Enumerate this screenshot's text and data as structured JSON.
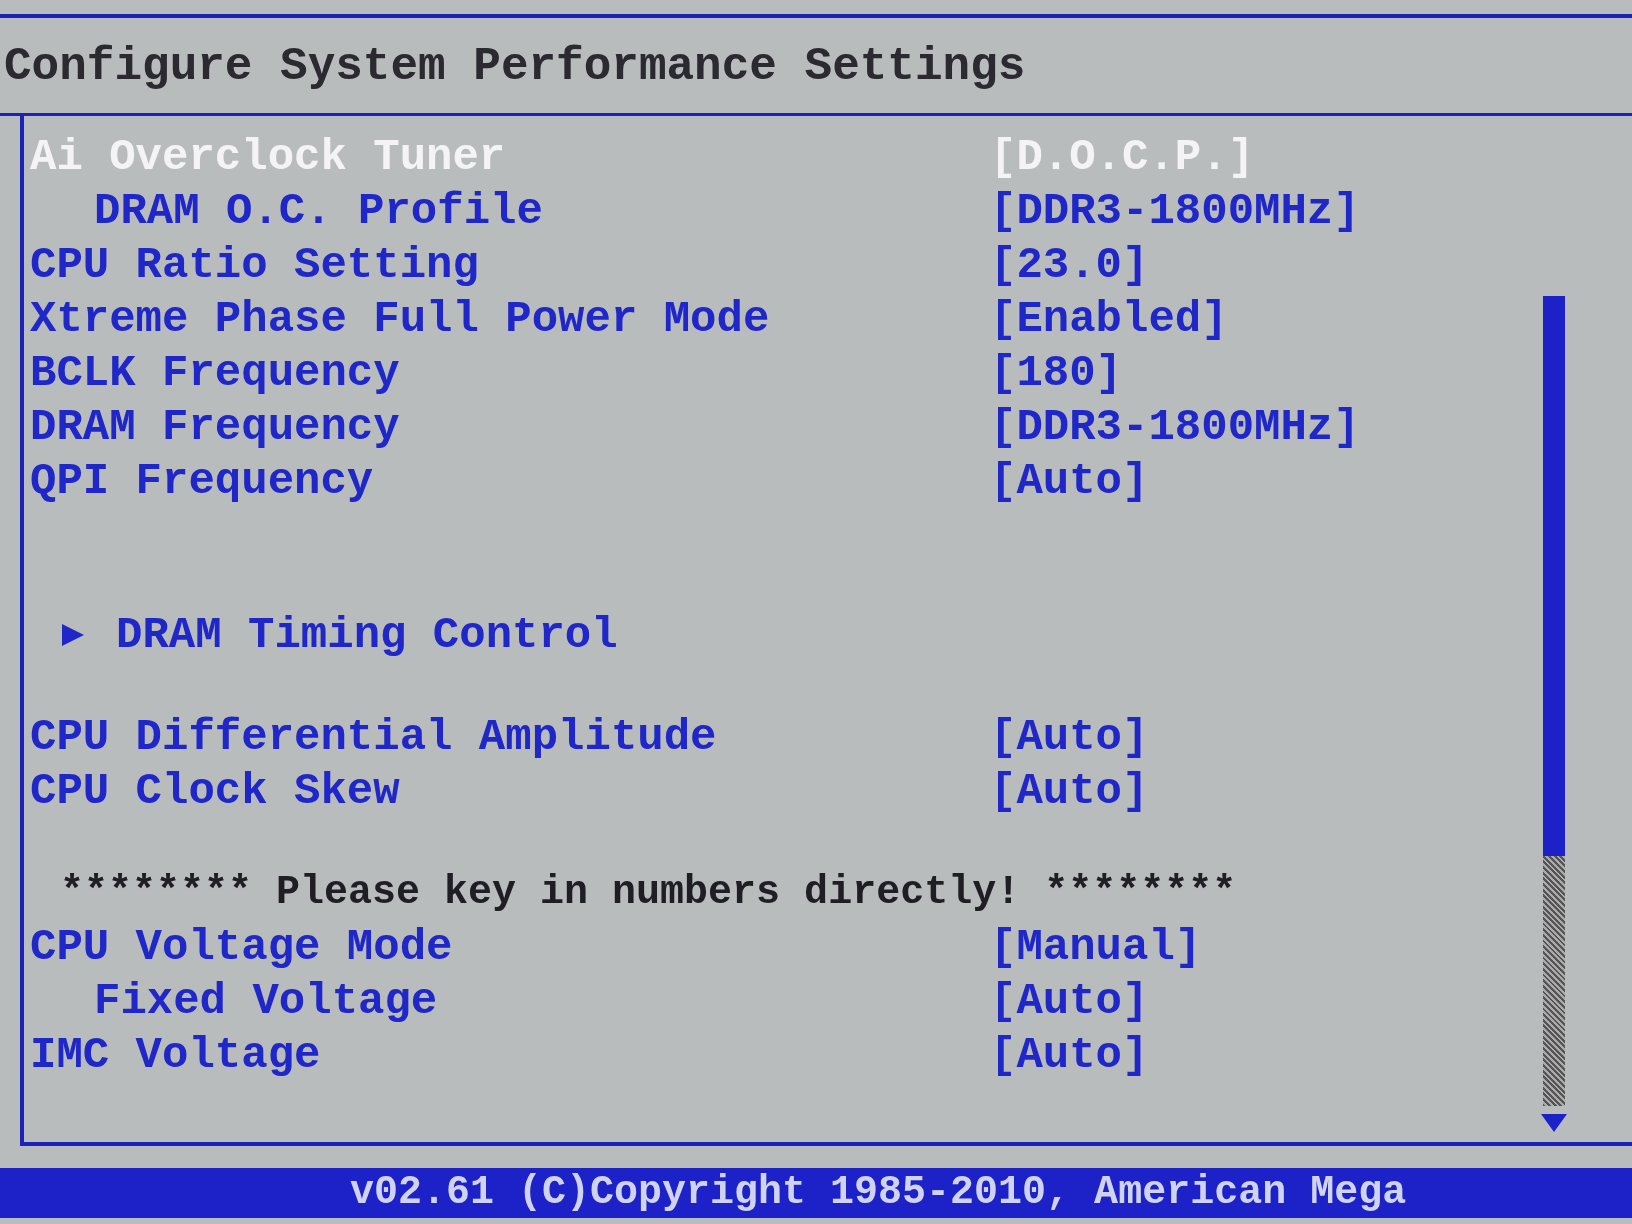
{
  "title": "Configure System Performance Settings",
  "groups": [
    {
      "items": [
        {
          "kind": "setting",
          "label": "Ai Overclock Tuner",
          "value": "[D.O.C.P.]",
          "selected": true,
          "children": [
            {
              "kind": "setting",
              "label": "DRAM O.C. Profile",
              "value": "[DDR3-1800MHz]",
              "selected": false
            }
          ]
        },
        {
          "kind": "setting",
          "label": "CPU Ratio Setting",
          "value": "[23.0]",
          "selected": false
        },
        {
          "kind": "setting",
          "label": "Xtreme Phase Full Power Mode",
          "value": "[Enabled]",
          "selected": false
        },
        {
          "kind": "setting",
          "label": "BCLK Frequency",
          "value": "[180]",
          "selected": false
        },
        {
          "kind": "setting",
          "label": "DRAM Frequency",
          "value": "[DDR3-1800MHz]",
          "selected": false
        },
        {
          "kind": "setting",
          "label": "QPI Frequency",
          "value": "[Auto]",
          "selected": false
        }
      ]
    },
    {
      "items": [
        {
          "kind": "submenu",
          "label": "DRAM Timing Control",
          "selected": false
        }
      ]
    },
    {
      "items": [
        {
          "kind": "setting",
          "label": "CPU Differential Amplitude",
          "value": "[Auto]",
          "selected": false
        },
        {
          "kind": "setting",
          "label": "CPU Clock Skew",
          "value": "[Auto]",
          "selected": false
        }
      ]
    },
    {
      "items": [
        {
          "kind": "note",
          "label": "******** Please key in numbers directly! ********"
        },
        {
          "kind": "setting",
          "label": "CPU Voltage Mode",
          "value": "[Manual]",
          "selected": false,
          "children": [
            {
              "kind": "setting",
              "label": "Fixed Voltage",
              "value": "[Auto]",
              "selected": false
            }
          ]
        },
        {
          "kind": "setting",
          "label": "IMC Voltage",
          "value": "[Auto]",
          "selected": false
        }
      ]
    }
  ],
  "footer": "v02.61 (C)Copyright 1985-2010, American Mega"
}
